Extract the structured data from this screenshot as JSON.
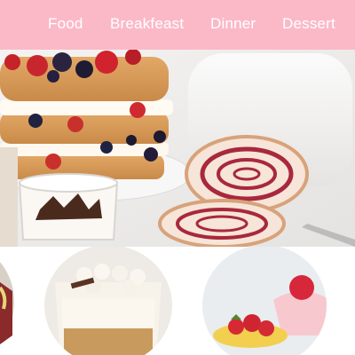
{
  "nav": {
    "items": [
      {
        "label": "Food"
      },
      {
        "label": "Breakfeast"
      },
      {
        "label": "Dinner"
      },
      {
        "label": "Dessert"
      }
    ]
  },
  "colors": {
    "nav_background": "#fbb9c8",
    "nav_text": "#ffffff",
    "page_background": "#ffffff"
  },
  "hero": {
    "image": "cake-and-swiss-roll-photo"
  },
  "thumbnails": [
    {
      "image": "dessert-cup-photo-partial"
    },
    {
      "image": "marshmallow-trifle-photo"
    },
    {
      "image": "strawberry-dessert-photo"
    }
  ]
}
